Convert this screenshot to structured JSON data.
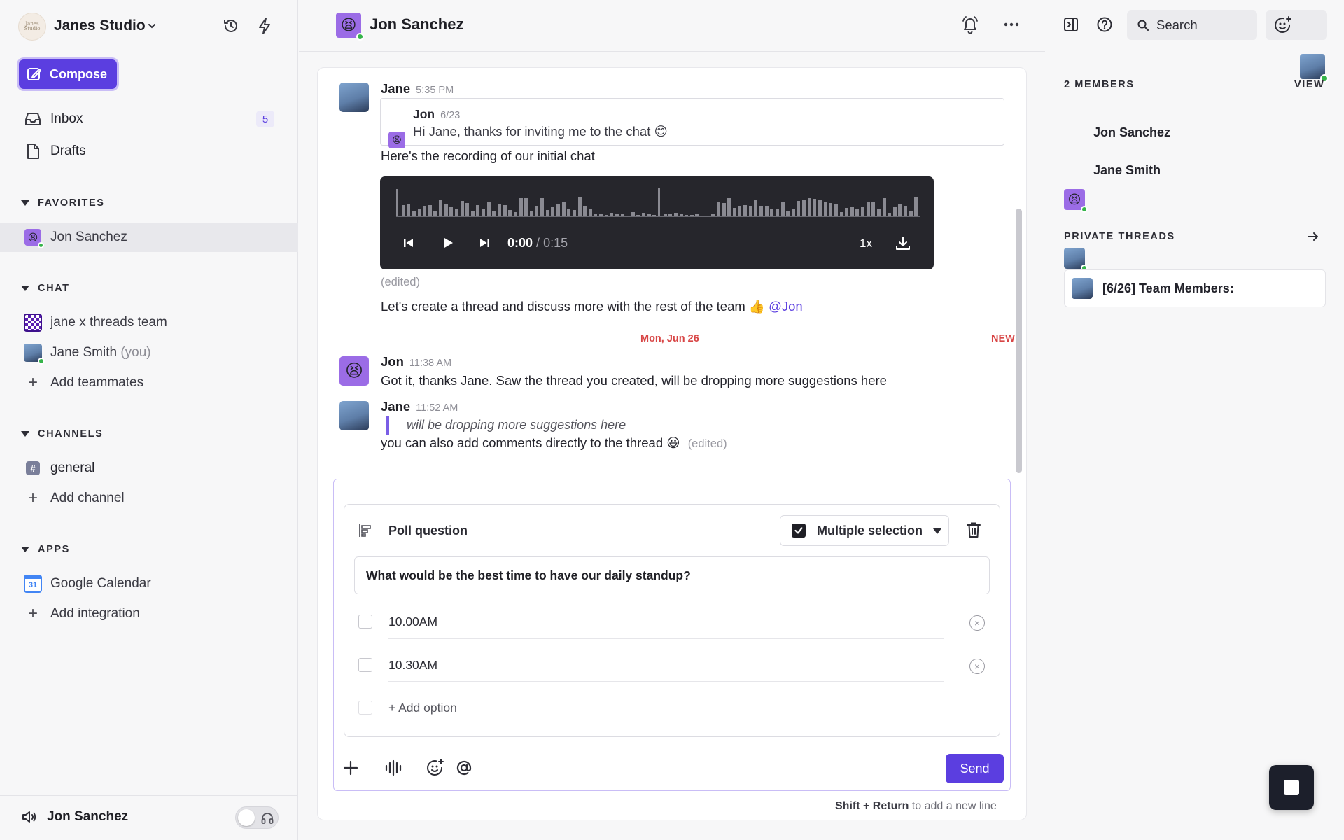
{
  "workspace": {
    "name": "Janes Studio",
    "logo_text": "Janes Studio"
  },
  "sidebar": {
    "compose_label": "Compose",
    "nav": [
      {
        "label": "Inbox",
        "badge": "5",
        "icon": "inbox-icon"
      },
      {
        "label": "Drafts",
        "icon": "file-icon"
      }
    ],
    "favorites": {
      "heading": "FAVORITES",
      "items": [
        {
          "label": "Jon Sanchez"
        }
      ]
    },
    "chat": {
      "heading": "CHAT",
      "items": [
        {
          "label": "jane x threads team"
        },
        {
          "label": "Jane Smith",
          "suffix": "(you)"
        }
      ],
      "add_label": "Add teammates"
    },
    "channels": {
      "heading": "CHANNELS",
      "items": [
        {
          "label": "general"
        }
      ],
      "add_label": "Add channel"
    },
    "apps": {
      "heading": "APPS",
      "items": [
        {
          "label": "Google Calendar",
          "icon_text": "31"
        }
      ],
      "add_label": "Add integration"
    },
    "footer_user": "Jon Sanchez"
  },
  "header": {
    "title": "Jon Sanchez"
  },
  "messages": [
    {
      "author": "Jane",
      "time": "5:35 PM",
      "quote": {
        "author": "Jon",
        "date": "6/23",
        "text": "Hi Jane, thanks for inviting me to the chat 😊"
      },
      "text": "Here's the recording of our initial chat",
      "audio": {
        "current": "0:00",
        "separator": "/",
        "duration": "0:15",
        "speed": "1x"
      },
      "edited": "(edited)",
      "text2": "Let's create a thread and discuss more with the rest of the team 👍",
      "mention": "@Jon"
    },
    {
      "divider_date": "Mon, Jun 26",
      "divider_new": "NEW"
    },
    {
      "author": "Jon",
      "time": "11:38 AM",
      "text": "Got it, thanks Jane. Saw the thread you created, will be dropping more suggestions here"
    },
    {
      "author": "Jane",
      "time": "11:52 AM",
      "reply_quote": "will be dropping more suggestions here",
      "text": "you can also add comments directly to the thread 😃",
      "edited": "(edited)"
    }
  ],
  "poll": {
    "title": "Poll question",
    "selection_label": "Multiple selection",
    "question": "What would be the best time to have our daily standup?",
    "options": [
      "10.00AM",
      "10.30AM"
    ],
    "add_option": "+ Add option"
  },
  "composer": {
    "send_label": "Send",
    "hint_key": "Shift + Return",
    "hint_rest": "to add a new line"
  },
  "right_panel": {
    "search_label": "Search",
    "members_heading": "2 MEMBERS",
    "view_label": "VIEW",
    "members": [
      "Jon Sanchez",
      "Jane Smith"
    ],
    "threads_heading": "PRIVATE THREADS",
    "threads": [
      "[6/26] Team Members:"
    ]
  },
  "colors": {
    "accent": "#5b3ee0",
    "new_divider": "#e04a4a",
    "online": "#36b44a",
    "audio_bg": "#26262c"
  }
}
